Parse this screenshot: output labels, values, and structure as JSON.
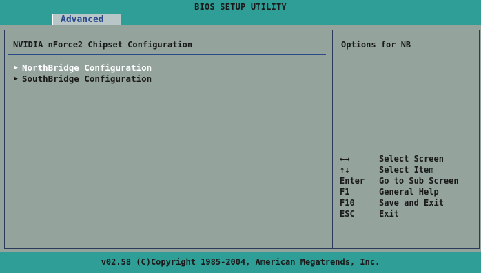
{
  "window": {
    "title": "BIOS SETUP UTILITY"
  },
  "tabs": [
    {
      "label": "Advanced",
      "active": true
    }
  ],
  "main": {
    "page_title": "NVIDIA nForce2 Chipset Configuration",
    "items": [
      {
        "label": "NorthBridge Configuration",
        "selected": true
      },
      {
        "label": "SouthBridge Configuration",
        "selected": false
      }
    ]
  },
  "help": {
    "text": "Options for NB",
    "legend": [
      {
        "key": "←→",
        "action": "Select Screen"
      },
      {
        "key": "↑↓",
        "action": "Select Item"
      },
      {
        "key": "Enter",
        "action": "Go to Sub Screen"
      },
      {
        "key": "F1",
        "action": "General Help"
      },
      {
        "key": "F10",
        "action": "Save and Exit"
      },
      {
        "key": "ESC",
        "action": "Exit"
      }
    ]
  },
  "footer": {
    "text": "v02.58 (C)Copyright 1985-2004, American Megatrends, Inc."
  },
  "colors": {
    "bar_teal": "#2e9e96",
    "panel_gray": "#94a49c",
    "tab_background": "#b8c6c8",
    "tab_text": "#2a4a8a",
    "selected_text": "#ffffff",
    "normal_text": "#1a1a1a"
  },
  "icons": {
    "submenu_arrow": "submenu-arrow-icon"
  }
}
